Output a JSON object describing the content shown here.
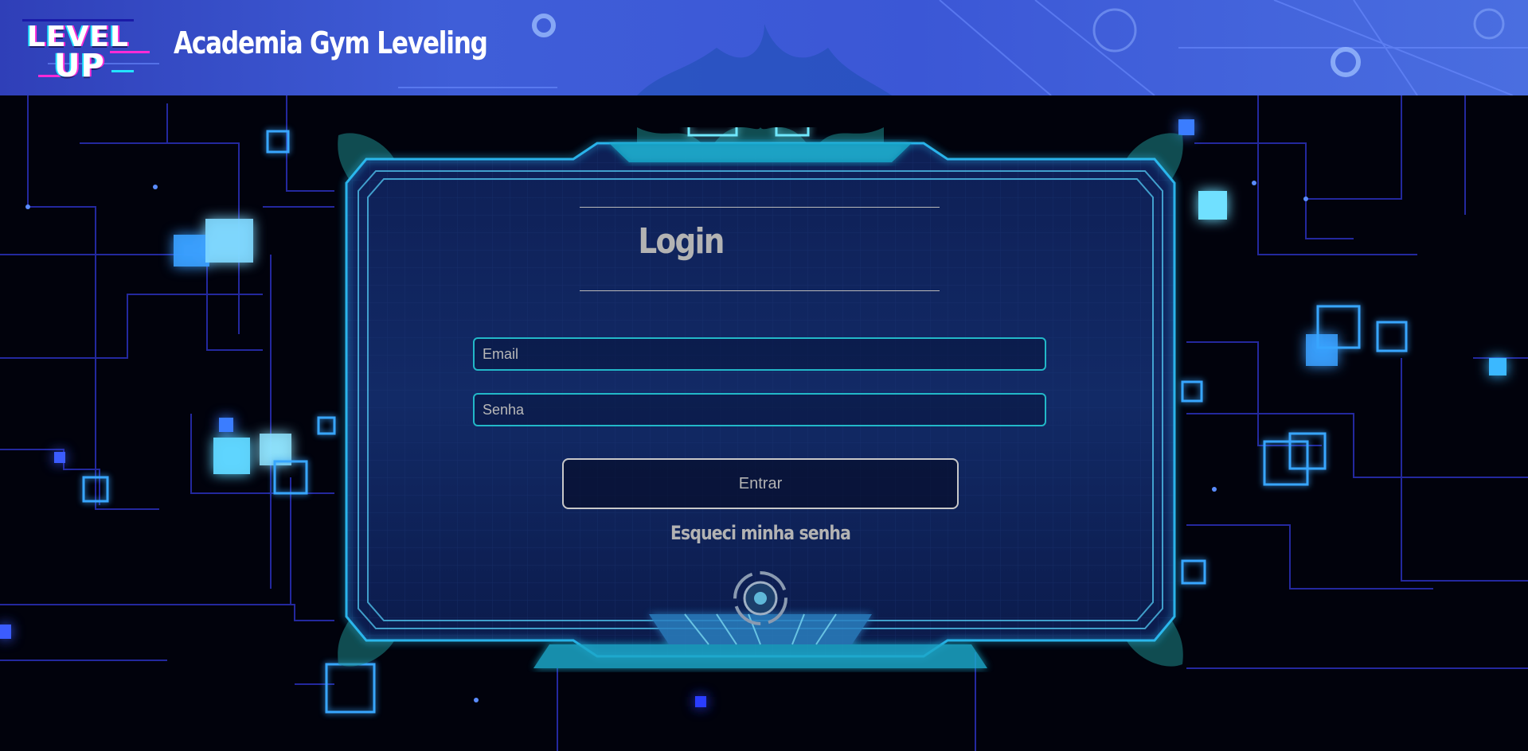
{
  "header": {
    "logo_line1": "LEVEL",
    "logo_line2": "UP",
    "site_title": "Academia Gym Leveling"
  },
  "login": {
    "title": "Login",
    "email_placeholder": "Email",
    "password_placeholder": "Senha",
    "submit_label": "Entrar",
    "forgot_label": "Esqueci minha senha"
  },
  "colors": {
    "header_blue": "#3b57d6",
    "field_border": "#22b8c8",
    "frame_glow": "#2ec6ff",
    "text_gray": "#b3b3b3"
  },
  "icons": {
    "logo": "level-up-logo",
    "emblem": "circle-emblem-icon"
  }
}
